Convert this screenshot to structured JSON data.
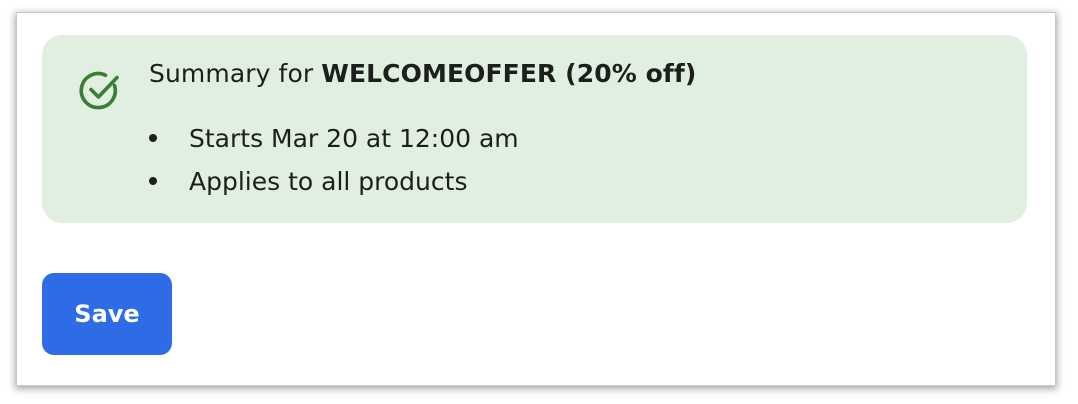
{
  "summary": {
    "title_prefix": "Summary for ",
    "title_code": "WELCOMEOFFER (20% off)",
    "items": [
      "Starts Mar 20 at 12:00 am",
      "Applies to all products"
    ],
    "icon": "check-circle-icon",
    "icon_color": "#3a7d34",
    "background_color": "#e1efe0"
  },
  "actions": {
    "save_label": "Save",
    "save_color": "#2e6be6"
  }
}
